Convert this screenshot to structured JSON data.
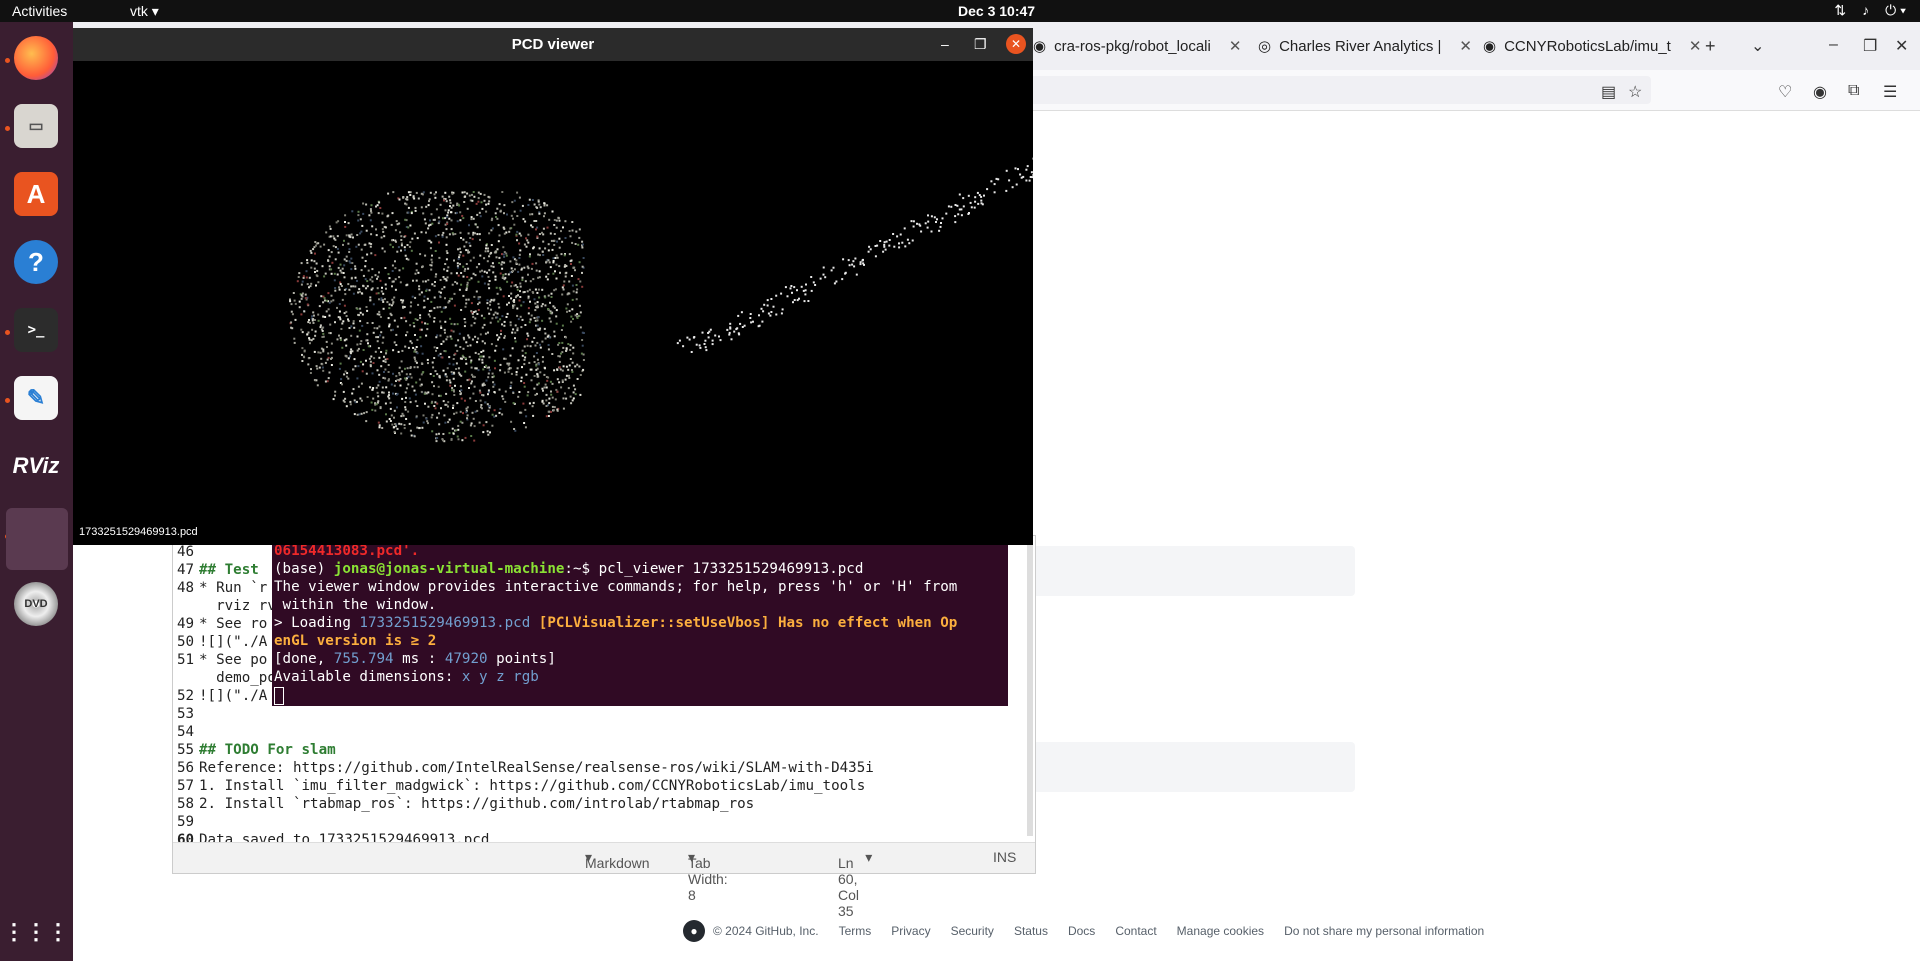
{
  "topbar": {
    "activities": "Activities",
    "app_menu": "vtk ▾",
    "clock": "Dec 3  10:47",
    "tray_icons": [
      "network-icon",
      "volume-icon",
      "power-icon"
    ]
  },
  "dock": {
    "items": [
      "firefox-icon",
      "files-icon",
      "software-center-icon",
      "help-icon",
      "terminal-icon",
      "text-editor-icon",
      "rviz-icon",
      "vtk-app-icon",
      "dvd-icon",
      "show-apps-icon"
    ],
    "rviz_label": "RViz"
  },
  "browser": {
    "tabs": [
      {
        "label": "cra-ros-pkg/robot_locali"
      },
      {
        "label": "Charles River Analytics |"
      },
      {
        "label": "CCNYRoboticsLab/imu_t"
      }
    ],
    "footer": {
      "copyright": "© 2024 GitHub, Inc.",
      "links": [
        "Terms",
        "Privacy",
        "Security",
        "Status",
        "Docs",
        "Contact",
        "Manage cookies",
        "Do not share my personal information"
      ]
    }
  },
  "pcd_viewer": {
    "title": "PCD viewer",
    "filename_overlay": "1733251529469913.pcd"
  },
  "terminal": {
    "line0": "06154413083.pcd'.",
    "prompt_base": "(base) ",
    "prompt_user": "jonas@jonas-virtual-machine",
    "prompt_path": ":~$ ",
    "command": "pcl_viewer 1733251529469913.pcd",
    "line2": "The viewer window provides interactive commands; for help, press 'h' or 'H' from",
    "line3": " within the window.",
    "line4_prefix": "> Loading ",
    "line4_file": "1733251529469913.pcd",
    "line4_warn": " [PCLVisualizer::setUseVbos] Has no effect when Op",
    "line5": "enGL version is ≥ 2",
    "line6_a": "[done, ",
    "line6_ms": "755.794",
    "line6_b": " ms : ",
    "line6_pts": "47920",
    "line6_c": " points]",
    "line7_a": "Available dimensions: ",
    "line7_dims": "x y z rgb"
  },
  "editor": {
    "lines": [
      {
        "n": "46",
        "t": ""
      },
      {
        "n": "47",
        "t": "## Test"
      },
      {
        "n": "48",
        "t": "* Run `r"
      },
      {
        "n": "",
        "t": "  rviz rvi"
      },
      {
        "n": "49",
        "t": "* See ro"
      },
      {
        "n": "50",
        "t": "![](\"./A"
      },
      {
        "n": "51",
        "t": "* See po"
      },
      {
        "n": "",
        "t": "  demo_poi"
      },
      {
        "n": "52",
        "t": "![](\"./A"
      },
      {
        "n": "53",
        "t": ""
      },
      {
        "n": "54",
        "t": ""
      },
      {
        "n": "55",
        "t": "## TODO For slam"
      },
      {
        "n": "56",
        "t": "Reference: https://github.com/IntelRealSense/realsense-ros/wiki/SLAM-with-D435i"
      },
      {
        "n": "57",
        "t": "1. Install `imu_filter_madgwick`: https://github.com/CCNYRoboticsLab/imu_tools"
      },
      {
        "n": "58",
        "t": "2. Install `rtabmap_ros`: https://github.com/introlab/rtabmap_ros"
      },
      {
        "n": "59",
        "t": ""
      },
      {
        "n": "60",
        "t": "Data saved to 1733251529469913.pcd"
      }
    ],
    "status": {
      "language": "Markdown",
      "tab_width": "Tab Width: 8",
      "position": "Ln 60, Col 35",
      "mode": "INS"
    }
  },
  "colors": {
    "dock_bg": "#3a1e30",
    "terminal_bg": "#300a24",
    "accent": "#e95420"
  }
}
